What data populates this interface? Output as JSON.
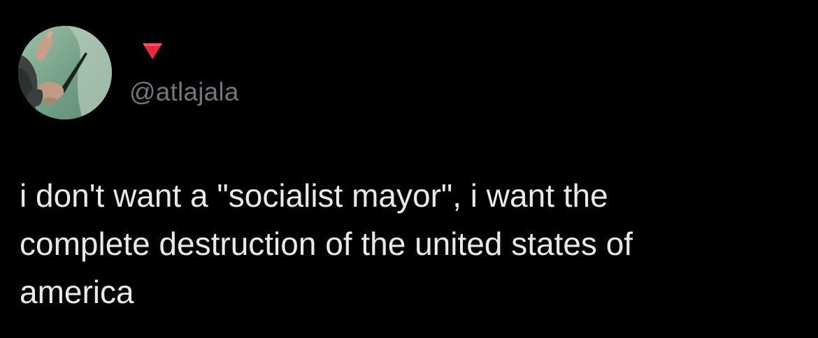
{
  "tweet": {
    "author": {
      "display_name": "",
      "display_name_emoji": "red-down-triangle-icon",
      "handle": "@atlajala",
      "avatar": "profile-avatar-photo"
    },
    "text": "i don't want a \"socialist mayor\", i want the\ncomplete destruction of the united states of\namerica"
  },
  "colors": {
    "background": "#000000",
    "primary_text": "#e7e9ea",
    "secondary_text": "#71767b",
    "emoji_red": "#e8283c"
  }
}
